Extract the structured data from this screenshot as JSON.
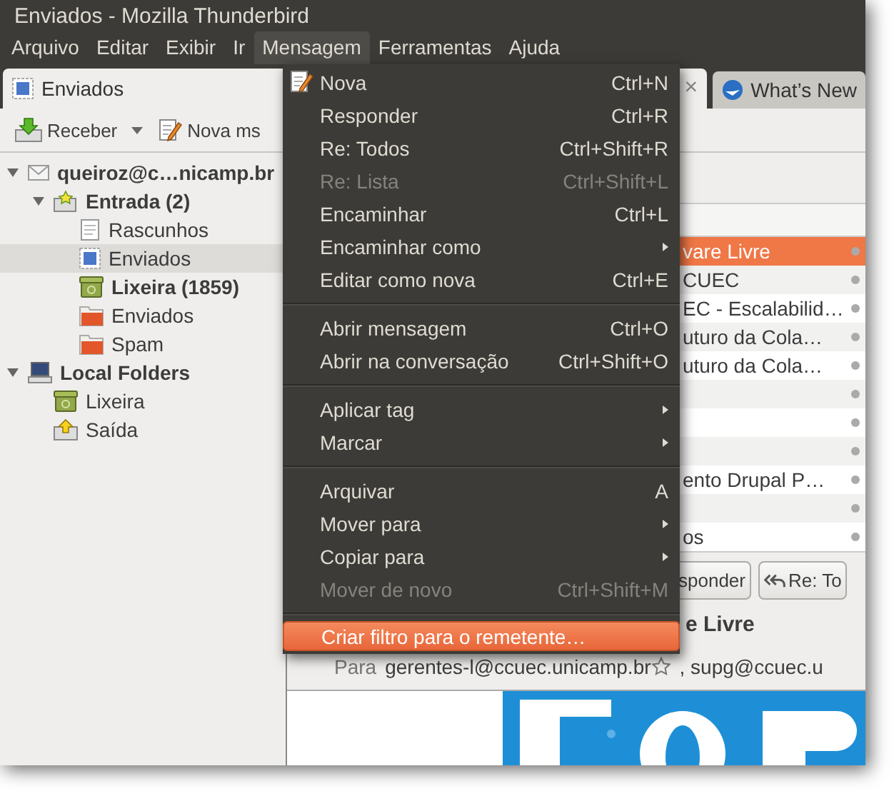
{
  "window": {
    "title": "Enviados - Mozilla Thunderbird"
  },
  "menubar": [
    {
      "label": "Arquivo",
      "selected": false
    },
    {
      "label": "Editar",
      "selected": false
    },
    {
      "label": "Exibir",
      "selected": false
    },
    {
      "label": "Ir",
      "selected": false
    },
    {
      "label": "Mensagem",
      "selected": true
    },
    {
      "label": "Ferramentas",
      "selected": false
    },
    {
      "label": "Ajuda",
      "selected": false
    }
  ],
  "tabs": [
    {
      "label": "Enviados",
      "selected": true,
      "close": "×"
    },
    {
      "label": "What’s New",
      "selected": false
    }
  ],
  "toolbar": {
    "get_mail": "Receber",
    "write": "Nova ms"
  },
  "folders": [
    {
      "kind": "account",
      "label": "queiroz@c…nicamp.br",
      "unread": true,
      "selected": false,
      "expanded": true,
      "children": [
        {
          "kind": "inbox",
          "label": "Entrada (2)",
          "unread": true,
          "selected": false,
          "expanded": true,
          "children": [
            {
              "kind": "drafts",
              "label": "Rascunhos",
              "unread": false,
              "selected": false
            },
            {
              "kind": "sent",
              "label": "Enviados",
              "unread": false,
              "selected": true
            },
            {
              "kind": "trash",
              "label": "Lixeira (1859)",
              "unread": true,
              "selected": false
            },
            {
              "kind": "folder",
              "label": "Enviados",
              "unread": false,
              "selected": false
            },
            {
              "kind": "folder",
              "label": "Spam",
              "unread": false,
              "selected": false
            }
          ]
        }
      ]
    },
    {
      "kind": "local",
      "label": "Local Folders",
      "unread": true,
      "selected": false,
      "expanded": true,
      "children": [
        {
          "kind": "trash",
          "label": "Lixeira",
          "unread": false,
          "selected": false
        },
        {
          "kind": "outbox",
          "label": "Saída",
          "unread": false,
          "selected": false
        }
      ]
    }
  ],
  "messages": [
    {
      "subject": "vare Livre",
      "selected": true
    },
    {
      "subject": "CUEC",
      "selected": false
    },
    {
      "subject": "EC - Escalabilid…",
      "selected": false
    },
    {
      "subject": "uturo da Cola…",
      "selected": false
    },
    {
      "subject": "uturo da Cola…",
      "selected": false
    },
    {
      "selected": false
    },
    {
      "selected": false
    },
    {
      "selected": false
    },
    {
      "subject": "ento Drupal P…",
      "selected": false
    },
    {
      "selected": false
    },
    {
      "subject": "os",
      "selected": false
    }
  ],
  "message_header": {
    "buttons": [
      {
        "kind": "reply",
        "label": "sponder"
      },
      {
        "kind": "reply_all",
        "label": "Re: To"
      }
    ],
    "subject": "e Livre",
    "to_label": "Para",
    "recipients": [
      "gerentes-l@ccuec.unicamp.br",
      ", supg@ccuec.u"
    ]
  },
  "menu": {
    "items": [
      {
        "kind": "with_icon",
        "label": "Nova",
        "shortcut": "Ctrl+N",
        "disabled": false,
        "submenu": false,
        "selected": false
      },
      {
        "kind": "command",
        "label": "Responder",
        "shortcut": "Ctrl+R",
        "disabled": false,
        "submenu": false,
        "selected": false
      },
      {
        "kind": "command",
        "label": "Re: Todos",
        "shortcut": "Ctrl+Shift+R",
        "disabled": false,
        "submenu": false,
        "selected": false
      },
      {
        "kind": "command",
        "label": "Re: Lista",
        "shortcut": "Ctrl+Shift+L",
        "disabled": true,
        "submenu": false,
        "selected": false
      },
      {
        "kind": "command",
        "label": "Encaminhar",
        "shortcut": "Ctrl+L",
        "disabled": false,
        "submenu": false,
        "selected": false
      },
      {
        "kind": "command",
        "label": "Encaminhar como",
        "disabled": false,
        "submenu": true,
        "selected": false
      },
      {
        "kind": "command",
        "label": "Editar como nova",
        "shortcut": "Ctrl+E",
        "disabled": false,
        "submenu": false,
        "selected": false
      },
      {
        "kind": "separator"
      },
      {
        "kind": "command",
        "label": "Abrir mensagem",
        "shortcut": "Ctrl+O",
        "disabled": false,
        "submenu": false,
        "selected": false
      },
      {
        "kind": "command",
        "label": "Abrir na conversação",
        "shortcut": "Ctrl+Shift+O",
        "disabled": false,
        "submenu": false,
        "selected": false
      },
      {
        "kind": "separator"
      },
      {
        "kind": "command",
        "label": "Aplicar tag",
        "disabled": false,
        "submenu": true,
        "selected": false
      },
      {
        "kind": "command",
        "label": "Marcar",
        "disabled": false,
        "submenu": true,
        "selected": false
      },
      {
        "kind": "separator"
      },
      {
        "kind": "command",
        "label": "Arquivar",
        "shortcut": "A",
        "disabled": false,
        "submenu": false,
        "selected": false
      },
      {
        "kind": "command",
        "label": "Mover para",
        "disabled": false,
        "submenu": true,
        "selected": false
      },
      {
        "kind": "command",
        "label": "Copiar para",
        "disabled": false,
        "submenu": true,
        "selected": false
      },
      {
        "kind": "command",
        "label": "Mover de novo",
        "shortcut": "Ctrl+Shift+M",
        "disabled": true,
        "submenu": false,
        "selected": false
      },
      {
        "kind": "separator"
      },
      {
        "kind": "command",
        "label": "Criar filtro para o remetente…",
        "disabled": false,
        "submenu": false,
        "selected": true
      }
    ]
  }
}
